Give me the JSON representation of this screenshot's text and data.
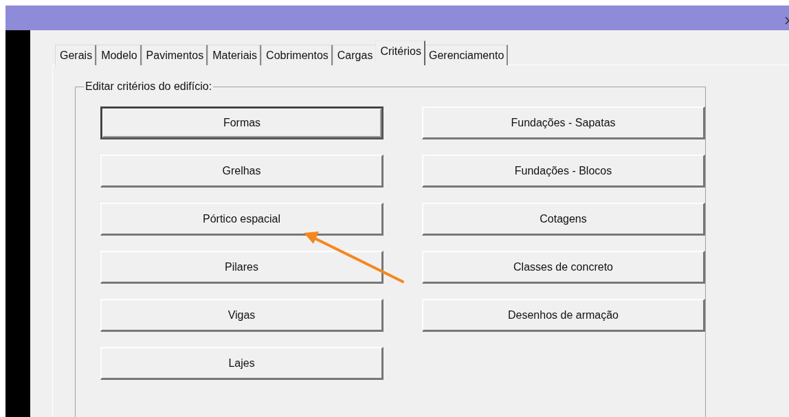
{
  "tabs": [
    {
      "label": "Gerais",
      "selected": false
    },
    {
      "label": "Modelo",
      "selected": false
    },
    {
      "label": "Pavimentos",
      "selected": false
    },
    {
      "label": "Materiais",
      "selected": false
    },
    {
      "label": "Cobrimentos",
      "selected": false
    },
    {
      "label": "Cargas",
      "selected": false
    },
    {
      "label": "Critérios",
      "selected": true
    },
    {
      "label": "Gerenciamento",
      "selected": false
    }
  ],
  "group": {
    "title": "Editar critérios do edifício:",
    "left_buttons": [
      {
        "label": "Formas",
        "default": true
      },
      {
        "label": "Grelhas",
        "default": false
      },
      {
        "label": "Pórtico espacial",
        "default": false
      },
      {
        "label": "Pilares",
        "default": false
      },
      {
        "label": "Vigas",
        "default": false
      },
      {
        "label": "Lajes",
        "default": false
      }
    ],
    "right_buttons": [
      {
        "label": "Fundações - Sapatas",
        "default": false
      },
      {
        "label": "Fundações - Blocos",
        "default": false
      },
      {
        "label": "Cotagens",
        "default": false
      },
      {
        "label": "Classes de concreto",
        "default": false
      },
      {
        "label": "Desenhos de armação",
        "default": false
      }
    ]
  }
}
